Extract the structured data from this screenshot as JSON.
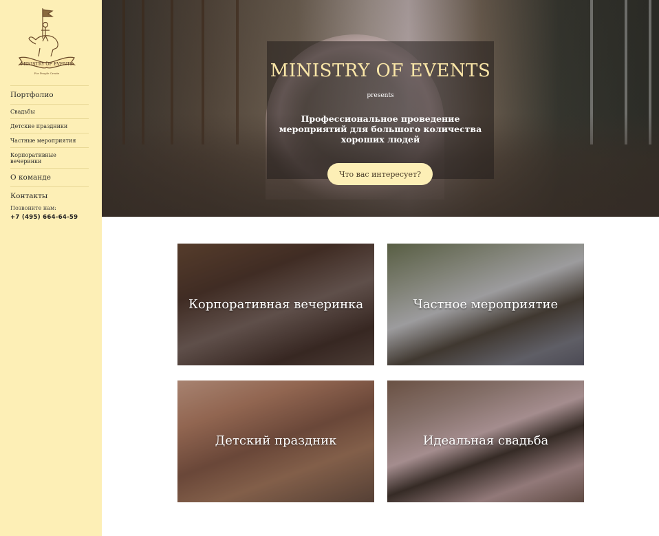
{
  "sidebar": {
    "logo": {
      "brand": "MINISTRY OF EVENTS",
      "tagline": "For People Create"
    },
    "nav": [
      {
        "label": "Портфолио",
        "level": "main"
      },
      {
        "label": "Свадьбы",
        "level": "sub"
      },
      {
        "label": "Детские праздники",
        "level": "sub"
      },
      {
        "label": "Частные мероприятия",
        "level": "sub"
      },
      {
        "label": "Корпоративные вечеринки",
        "level": "sub"
      },
      {
        "label": "О команде",
        "level": "main"
      },
      {
        "label": "Контакты",
        "level": "main"
      }
    ],
    "call_label": "Позвоните нам:",
    "phone": "+7 (495) 664-64-59"
  },
  "hero": {
    "title": "MINISTRY OF EVENTS",
    "presents": "presents",
    "subtitle": "Профессиональное проведение мероприятий для большого количества хороших людей",
    "cta_label": "Что вас интересует?"
  },
  "cards": [
    {
      "label": "Корпоративная вечеринка"
    },
    {
      "label": "Частное мероприятие"
    },
    {
      "label": "Детский праздник"
    },
    {
      "label": "Идеальная свадьба"
    }
  ],
  "colors": {
    "sidebar_bg": "#fdefb6",
    "accent_gold": "#fbe7a8",
    "text_dark": "#2b2b2b"
  }
}
